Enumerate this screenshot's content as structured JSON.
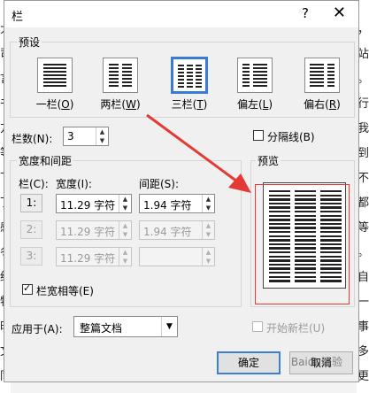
{
  "background_doc": {
    "left_glyphs": [
      "大",
      "司",
      "言",
      "书",
      "方",
      "等",
      "下",
      "丁",
      "感",
      "冬",
      "绉",
      "特",
      "时",
      "文",
      "同"
    ],
    "right_glyphs": [
      "，",
      "站",
      "。",
      "行",
      "我",
      "到",
      "不",
      "都",
      "等",
      "。",
      "自",
      "一",
      "事",
      "多",
      "更"
    ]
  },
  "dialog": {
    "title": "栏",
    "help": "?",
    "close": "✕"
  },
  "presets": {
    "legend": "预设",
    "items": [
      {
        "label": "一栏(",
        "key": "O",
        "suffix": ")",
        "selected": false
      },
      {
        "label": "两栏(",
        "key": "W",
        "suffix": ")",
        "selected": false
      },
      {
        "label": "三栏(",
        "key": "T",
        "suffix": ")",
        "selected": true
      },
      {
        "label": "偏左(",
        "key": "L",
        "suffix": ")",
        "selected": false
      },
      {
        "label": "偏右(",
        "key": "R",
        "suffix": ")",
        "selected": false
      }
    ]
  },
  "columns": {
    "label": "栏数(N):",
    "value": "3"
  },
  "separator": {
    "label": "分隔线(B)",
    "checked": false
  },
  "width_spacing": {
    "legend": "宽度和间距",
    "col_header": "栏(C):",
    "width_header": "宽度(I):",
    "spacing_header": "间距(S):",
    "rows": [
      {
        "num": "1:",
        "width": "11.29 字符",
        "spacing": "1.94 字符",
        "enabled": true
      },
      {
        "num": "2:",
        "width": "11.29 字符",
        "spacing": "1.94 字符",
        "enabled": false
      },
      {
        "num": "3:",
        "width": "11.29 字符",
        "spacing": "",
        "enabled": false
      }
    ],
    "equal_width_label": "栏宽相等(E)",
    "equal_width_checked": true
  },
  "preview": {
    "legend": "预览",
    "columns": 3
  },
  "apply_to": {
    "label": "应用于(A):",
    "value": "整篇文档"
  },
  "new_column": {
    "label": "开始新栏(U)",
    "checked": false
  },
  "buttons": {
    "ok": "确定",
    "cancel": "取消"
  },
  "watermark": "Baidu经验",
  "colors": {
    "accent": "#3c7fd6",
    "annotation_red": "#e53935"
  }
}
